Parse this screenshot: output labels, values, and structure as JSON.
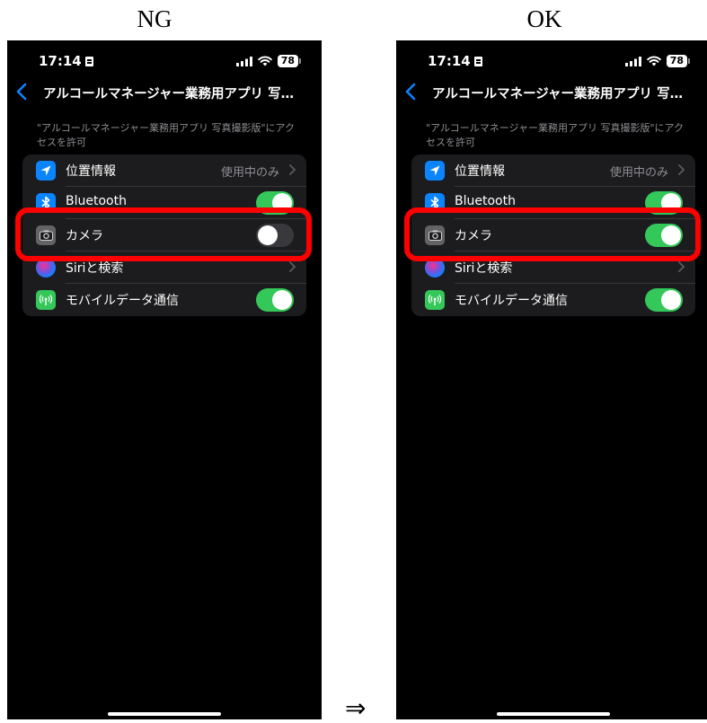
{
  "labels": {
    "left": "NG",
    "right": "OK",
    "arrow": "⇒"
  },
  "status_bar": {
    "time": "17:14",
    "battery": "78"
  },
  "nav": {
    "title": "アルコールマネージャー業務用アプリ 写…"
  },
  "caption": "\"アルコールマネージャー業務用アプリ 写真撮影版\"にアクセスを許可",
  "rows": {
    "location": {
      "label": "位置情報",
      "value": "使用中のみ"
    },
    "bluetooth": {
      "label": "Bluetooth"
    },
    "camera": {
      "label": "カメラ"
    },
    "siri": {
      "label": "Siriと検索"
    },
    "mobile": {
      "label": "モバイルデータ通信"
    }
  },
  "states": {
    "ng": {
      "bluetooth": true,
      "camera": false,
      "mobile": true
    },
    "ok": {
      "bluetooth": true,
      "camera": true,
      "mobile": true
    }
  },
  "colors": {
    "accent": "#0a84ff",
    "toggle_on": "#34c759",
    "highlight": "#ff0000"
  },
  "icons": [
    "location-icon",
    "bluetooth-icon",
    "camera-icon",
    "siri-icon",
    "antenna-icon"
  ]
}
